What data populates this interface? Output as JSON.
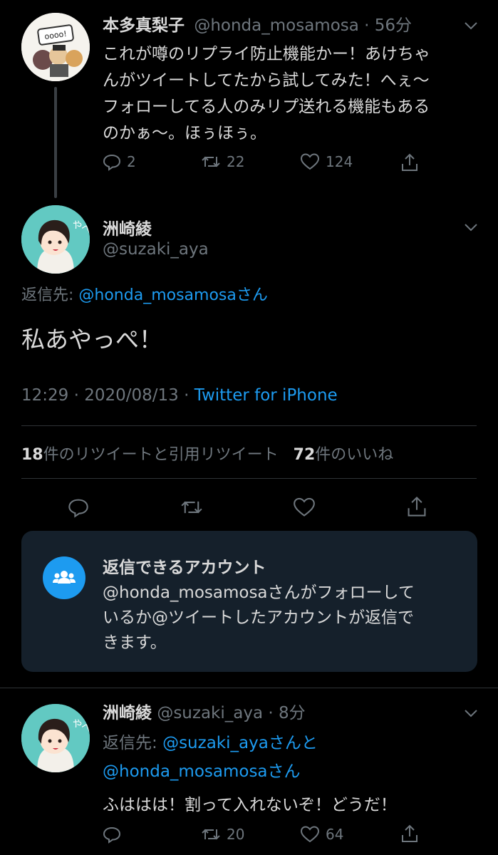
{
  "tweet1": {
    "name": "本多真梨子",
    "handle": "@honda_mosamosa",
    "time": "· 56分",
    "text_lines": [
      "これが噂のリプライ防止機能かー！あけちゃ",
      "んがツイートしてたから試してみた！へぇ〜",
      "フォローしてる人のみリプ送れる機能もある",
      "のかぁ〜。ほぅほぅ。"
    ],
    "replies": "2",
    "retweets": "22",
    "likes": "124"
  },
  "main_tweet": {
    "name": "洲崎綾",
    "handle": "@suzaki_aya",
    "reply_to_prefix": "返信先: ",
    "reply_to_handle": "@honda_mosamosa",
    "reply_to_suffix": "さん",
    "text": "私あやっぺ！",
    "timestamp": "12:29 · 2020/08/13 · ",
    "source": "Twitter for iPhone",
    "retweet_count": "18",
    "retweet_label": "件のリツイートと引用リツイート",
    "like_count": "72",
    "like_label": "件のいいね"
  },
  "reply_notice": {
    "title": "返信できるアカウント",
    "body_lines": [
      "@honda_mosamosaさんがフォローして",
      "いるか@ツイートしたアカウントが返信で",
      "きます。"
    ],
    "icon": "people-icon"
  },
  "tweet3": {
    "name": "洲崎綾",
    "handle": "@suzaki_aya",
    "time": "· 8分",
    "reply_prefix": "返信先: ",
    "reply_handle1": "@suzaki_aya",
    "reply_mid": "さんと",
    "reply_handle2": "@honda_mosamosa",
    "reply_suffix": "さん",
    "text": "ふははは！割って入れないぞ！どうだ！",
    "retweets": "20",
    "likes": "64"
  },
  "colors": {
    "background": "#000000",
    "link": "#1d9bf0",
    "muted": "#6e767d",
    "card": "#15202b"
  }
}
